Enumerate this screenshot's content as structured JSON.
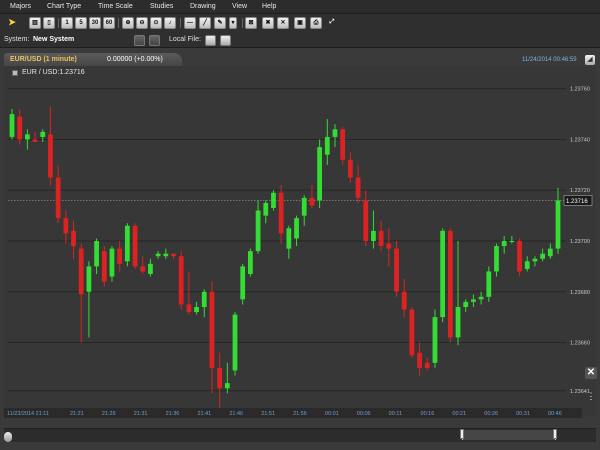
{
  "menu": [
    "Majors",
    "Chart Type",
    "Time Scale",
    "Studies",
    "Drawing",
    "View",
    "Help"
  ],
  "toolbar": {
    "timescale_buttons": [
      "1",
      "5",
      "30",
      "60"
    ]
  },
  "system_bar": {
    "system_label": "System:",
    "system_value": "New System",
    "local_file_label": "Local File:"
  },
  "tab": {
    "pair": "EUR/USD (1 minute)",
    "change": "0.00000 (+0.00%)",
    "datetime": "11/24/2014 00:46:59"
  },
  "legend": "EUR / USD:1.23716",
  "colors": {
    "up": "#33dd33",
    "down": "#dd2222",
    "background": "#373737",
    "grid": "#555555"
  },
  "chart_data": {
    "type": "candlestick",
    "symbol": "EUR / USD",
    "price_label": "1.23716",
    "y_ticks": [
      "1.23760",
      "1.23740",
      "1.23720",
      "1.23700",
      "1.23680",
      "1.23660",
      "1.23641"
    ],
    "y_tick_values": [
      1.2376,
      1.2374,
      1.2372,
      1.237,
      1.2368,
      1.2366,
      1.23641
    ],
    "ylim": [
      1.23635,
      1.23765
    ],
    "x_ticks": [
      "11/23/2014 21:11",
      "21:21",
      "21:26",
      "21:31",
      "21:36",
      "21:41",
      "21:46",
      "21:51",
      "21:56",
      "00:01",
      "00:06",
      "00:11",
      "00:16",
      "00:21",
      "00:26",
      "00:31",
      "00:46"
    ],
    "candles": [
      {
        "o": 1.23741,
        "h": 1.23752,
        "l": 1.2374,
        "c": 1.2375
      },
      {
        "o": 1.23749,
        "h": 1.23752,
        "l": 1.23738,
        "c": 1.2374
      },
      {
        "o": 1.2374,
        "h": 1.23744,
        "l": 1.23736,
        "c": 1.23742
      },
      {
        "o": 1.2374,
        "h": 1.23743,
        "l": 1.23739,
        "c": 1.23739
      },
      {
        "o": 1.23741,
        "h": 1.23744,
        "l": 1.23739,
        "c": 1.23743
      },
      {
        "o": 1.23742,
        "h": 1.23753,
        "l": 1.23722,
        "c": 1.23725
      },
      {
        "o": 1.23725,
        "h": 1.2373,
        "l": 1.23707,
        "c": 1.23709
      },
      {
        "o": 1.23709,
        "h": 1.23712,
        "l": 1.23699,
        "c": 1.23703
      },
      {
        "o": 1.23704,
        "h": 1.23708,
        "l": 1.23693,
        "c": 1.23698
      },
      {
        "o": 1.23697,
        "h": 1.23699,
        "l": 1.2366,
        "c": 1.23679
      },
      {
        "o": 1.2368,
        "h": 1.23692,
        "l": 1.23662,
        "c": 1.2369
      },
      {
        "o": 1.2369,
        "h": 1.23701,
        "l": 1.23687,
        "c": 1.237
      },
      {
        "o": 1.23696,
        "h": 1.23698,
        "l": 1.23682,
        "c": 1.23684
      },
      {
        "o": 1.23686,
        "h": 1.23698,
        "l": 1.23684,
        "c": 1.23697
      },
      {
        "o": 1.23697,
        "h": 1.237,
        "l": 1.23688,
        "c": 1.23691
      },
      {
        "o": 1.23692,
        "h": 1.23707,
        "l": 1.2369,
        "c": 1.23706
      },
      {
        "o": 1.23706,
        "h": 1.23707,
        "l": 1.23689,
        "c": 1.2369
      },
      {
        "o": 1.2369,
        "h": 1.23694,
        "l": 1.23687,
        "c": 1.23688
      },
      {
        "o": 1.23687,
        "h": 1.23693,
        "l": 1.23686,
        "c": 1.23691
      },
      {
        "o": 1.23694,
        "h": 1.23696,
        "l": 1.23693,
        "c": 1.23695
      },
      {
        "o": 1.23694,
        "h": 1.23697,
        "l": 1.23693,
        "c": 1.23695
      },
      {
        "o": 1.23695,
        "h": 1.23695,
        "l": 1.23693,
        "c": 1.23694
      },
      {
        "o": 1.23694,
        "h": 1.23696,
        "l": 1.23673,
        "c": 1.23675
      },
      {
        "o": 1.23675,
        "h": 1.23688,
        "l": 1.23671,
        "c": 1.23672
      },
      {
        "o": 1.23672,
        "h": 1.23676,
        "l": 1.23671,
        "c": 1.23674
      },
      {
        "o": 1.23674,
        "h": 1.23681,
        "l": 1.2367,
        "c": 1.2368
      },
      {
        "o": 1.2368,
        "h": 1.23684,
        "l": 1.2364,
        "c": 1.2365
      },
      {
        "o": 1.2365,
        "h": 1.23656,
        "l": 1.23634,
        "c": 1.23642
      },
      {
        "o": 1.23642,
        "h": 1.23652,
        "l": 1.2364,
        "c": 1.23644
      },
      {
        "o": 1.23649,
        "h": 1.23672,
        "l": 1.23647,
        "c": 1.23671
      },
      {
        "o": 1.23677,
        "h": 1.23691,
        "l": 1.23675,
        "c": 1.2369
      },
      {
        "o": 1.23687,
        "h": 1.23697,
        "l": 1.23686,
        "c": 1.23696
      },
      {
        "o": 1.23696,
        "h": 1.23716,
        "l": 1.23695,
        "c": 1.23712
      },
      {
        "o": 1.2371,
        "h": 1.23716,
        "l": 1.23707,
        "c": 1.23715
      },
      {
        "o": 1.23713,
        "h": 1.2372,
        "l": 1.23712,
        "c": 1.23719
      },
      {
        "o": 1.23719,
        "h": 1.23722,
        "l": 1.23699,
        "c": 1.23703
      },
      {
        "o": 1.23697,
        "h": 1.23706,
        "l": 1.23693,
        "c": 1.23705
      },
      {
        "o": 1.23701,
        "h": 1.2371,
        "l": 1.23698,
        "c": 1.23709
      },
      {
        "o": 1.2371,
        "h": 1.23718,
        "l": 1.23706,
        "c": 1.23717
      },
      {
        "o": 1.23717,
        "h": 1.23722,
        "l": 1.23713,
        "c": 1.23714
      },
      {
        "o": 1.23716,
        "h": 1.2374,
        "l": 1.23713,
        "c": 1.23737
      },
      {
        "o": 1.23734,
        "h": 1.23748,
        "l": 1.2373,
        "c": 1.23741
      },
      {
        "o": 1.23741,
        "h": 1.23746,
        "l": 1.23737,
        "c": 1.23744
      },
      {
        "o": 1.23744,
        "h": 1.23745,
        "l": 1.2373,
        "c": 1.23732
      },
      {
        "o": 1.23732,
        "h": 1.23735,
        "l": 1.23723,
        "c": 1.23725
      },
      {
        "o": 1.23725,
        "h": 1.2373,
        "l": 1.23715,
        "c": 1.23717
      },
      {
        "o": 1.23716,
        "h": 1.2372,
        "l": 1.23698,
        "c": 1.237
      },
      {
        "o": 1.237,
        "h": 1.23712,
        "l": 1.23697,
        "c": 1.23704
      },
      {
        "o": 1.23704,
        "h": 1.23708,
        "l": 1.23696,
        "c": 1.23698
      },
      {
        "o": 1.23699,
        "h": 1.23705,
        "l": 1.2369,
        "c": 1.23697
      },
      {
        "o": 1.23697,
        "h": 1.237,
        "l": 1.23678,
        "c": 1.2368
      },
      {
        "o": 1.2368,
        "h": 1.23685,
        "l": 1.2367,
        "c": 1.23673
      },
      {
        "o": 1.23673,
        "h": 1.23674,
        "l": 1.23654,
        "c": 1.23655
      },
      {
        "o": 1.23656,
        "h": 1.2366,
        "l": 1.23647,
        "c": 1.2365
      },
      {
        "o": 1.23652,
        "h": 1.23654,
        "l": 1.23649,
        "c": 1.2365
      },
      {
        "o": 1.23652,
        "h": 1.23673,
        "l": 1.2365,
        "c": 1.2367
      },
      {
        "o": 1.2367,
        "h": 1.23705,
        "l": 1.23668,
        "c": 1.23704
      },
      {
        "o": 1.23704,
        "h": 1.23705,
        "l": 1.2366,
        "c": 1.23662
      },
      {
        "o": 1.23662,
        "h": 1.237,
        "l": 1.23659,
        "c": 1.23674
      },
      {
        "o": 1.23674,
        "h": 1.23677,
        "l": 1.23672,
        "c": 1.23676
      },
      {
        "o": 1.23676,
        "h": 1.23679,
        "l": 1.23674,
        "c": 1.23677
      },
      {
        "o": 1.23677,
        "h": 1.2368,
        "l": 1.23675,
        "c": 1.23678
      },
      {
        "o": 1.23678,
        "h": 1.2369,
        "l": 1.23676,
        "c": 1.23688
      },
      {
        "o": 1.23688,
        "h": 1.23699,
        "l": 1.23686,
        "c": 1.23698
      },
      {
        "o": 1.23698,
        "h": 1.23702,
        "l": 1.23695,
        "c": 1.237
      },
      {
        "o": 1.237,
        "h": 1.23702,
        "l": 1.23699,
        "c": 1.237
      },
      {
        "o": 1.237,
        "h": 1.23701,
        "l": 1.23686,
        "c": 1.23688
      },
      {
        "o": 1.23689,
        "h": 1.23694,
        "l": 1.23688,
        "c": 1.23692
      },
      {
        "o": 1.23692,
        "h": 1.23694,
        "l": 1.2369,
        "c": 1.23693
      },
      {
        "o": 1.23693,
        "h": 1.23697,
        "l": 1.23692,
        "c": 1.23695
      },
      {
        "o": 1.23694,
        "h": 1.23699,
        "l": 1.23693,
        "c": 1.23697
      },
      {
        "o": 1.23697,
        "h": 1.23721,
        "l": 1.23695,
        "c": 1.23716
      }
    ]
  }
}
